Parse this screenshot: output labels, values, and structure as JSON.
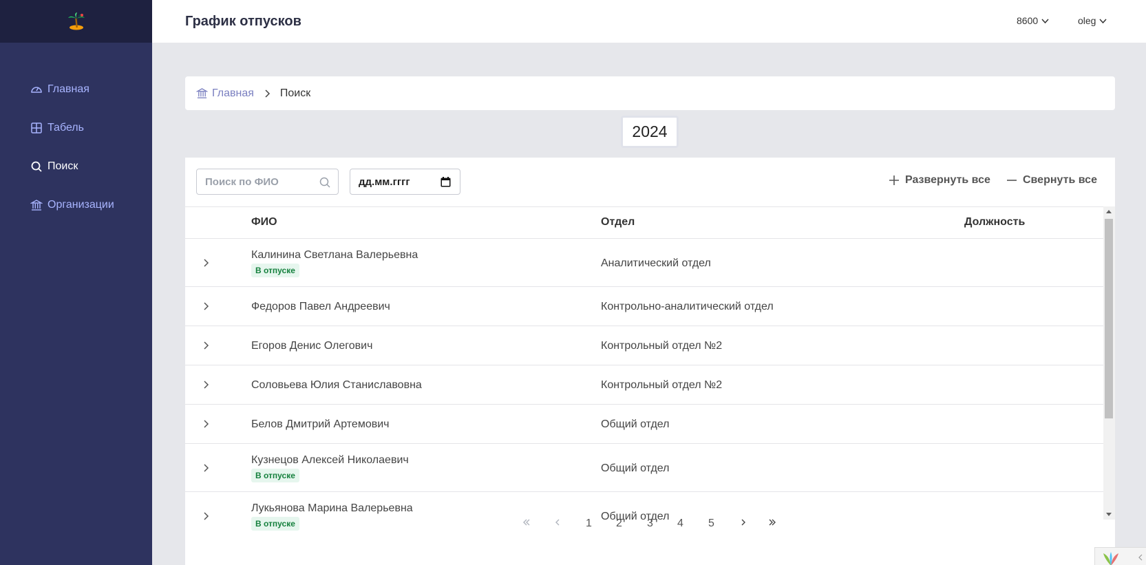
{
  "sidebar": {
    "logo_icon": "palm-tree-island-icon",
    "items": [
      {
        "label": "Главная",
        "icon": "dashboard-gauge-icon",
        "active": false
      },
      {
        "label": "Табель",
        "icon": "grid-table-icon",
        "active": false
      },
      {
        "label": "Поиск",
        "icon": "search-icon",
        "active": true
      },
      {
        "label": "Организации",
        "icon": "bank-building-icon",
        "active": false
      }
    ]
  },
  "header": {
    "title": "График отпусков",
    "org_selector": "8600",
    "user_menu": "oleg"
  },
  "breadcrumb": {
    "home_label": "Главная",
    "current_label": "Поиск"
  },
  "year": "2024",
  "toolbar": {
    "search_placeholder": "Поиск по ФИО",
    "date_placeholder": "дд.мм.гггг",
    "expand_all_label": "Развернуть все",
    "collapse_all_label": "Свернуть все"
  },
  "table": {
    "columns": [
      "ФИО",
      "Отдел",
      "Должность"
    ],
    "rows": [
      {
        "name": "Калинина Светлана Валерьевна",
        "dept": "Аналитический отдел",
        "badge": "В отпуске"
      },
      {
        "name": "Федоров Павел Андреевич",
        "dept": "Контрольно-аналитический отдел",
        "badge": ""
      },
      {
        "name": "Егоров Денис Олегович",
        "dept": "Контрольный отдел №2",
        "badge": ""
      },
      {
        "name": "Соловьева Юлия Станиславовна",
        "dept": "Контрольный отдел №2",
        "badge": ""
      },
      {
        "name": "Белов Дмитрий Артемович",
        "dept": "Общий отдел",
        "badge": ""
      },
      {
        "name": "Кузнецов Алексей Николаевич",
        "dept": "Общий отдел",
        "badge": "В отпуске"
      },
      {
        "name": "Лукьянова Марина Валерьевна",
        "dept": "Общий отдел",
        "badge": "В отпуске"
      }
    ]
  },
  "pagination": {
    "pages": [
      "1",
      "2",
      "3",
      "4",
      "5"
    ]
  },
  "colors": {
    "sidebar_bg": "#2e335f",
    "sidebar_link": "#a8b4ff",
    "badge_bg": "#e6f6ee",
    "badge_text": "#15803d"
  }
}
